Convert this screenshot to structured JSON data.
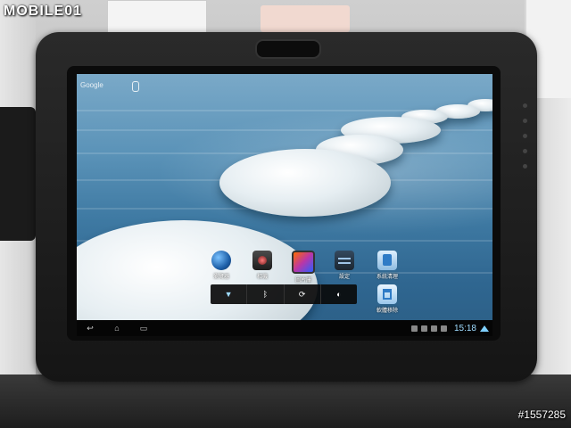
{
  "photo": {
    "watermark": "MOBILE01",
    "photo_id": "#1557285"
  },
  "search": {
    "label": "Google"
  },
  "apps": [
    {
      "label": "瀏覽器",
      "icon": "globe-icon"
    },
    {
      "label": "相機",
      "icon": "camera-icon"
    },
    {
      "label": "圖片庫",
      "icon": "gallery-icon"
    },
    {
      "label": "設定",
      "icon": "settings-icon"
    },
    {
      "label": "系統清理",
      "icon": "cleaner-icon"
    },
    {
      "label": "軟體移除",
      "icon": "uninstall-icon"
    }
  ],
  "power_widget": {
    "buttons": [
      {
        "name": "wifi",
        "glyph": "▼"
      },
      {
        "name": "bluetooth",
        "glyph": "ᛒ"
      },
      {
        "name": "sync",
        "glyph": "⟳"
      },
      {
        "name": "brightness",
        "glyph": "◐"
      }
    ]
  },
  "system_bar": {
    "back_glyph": "↩",
    "home_glyph": "⌂",
    "recent_glyph": "▭",
    "time": "15:18"
  },
  "colors": {
    "clock": "#9fdcff",
    "water": "#3f7aa3"
  }
}
